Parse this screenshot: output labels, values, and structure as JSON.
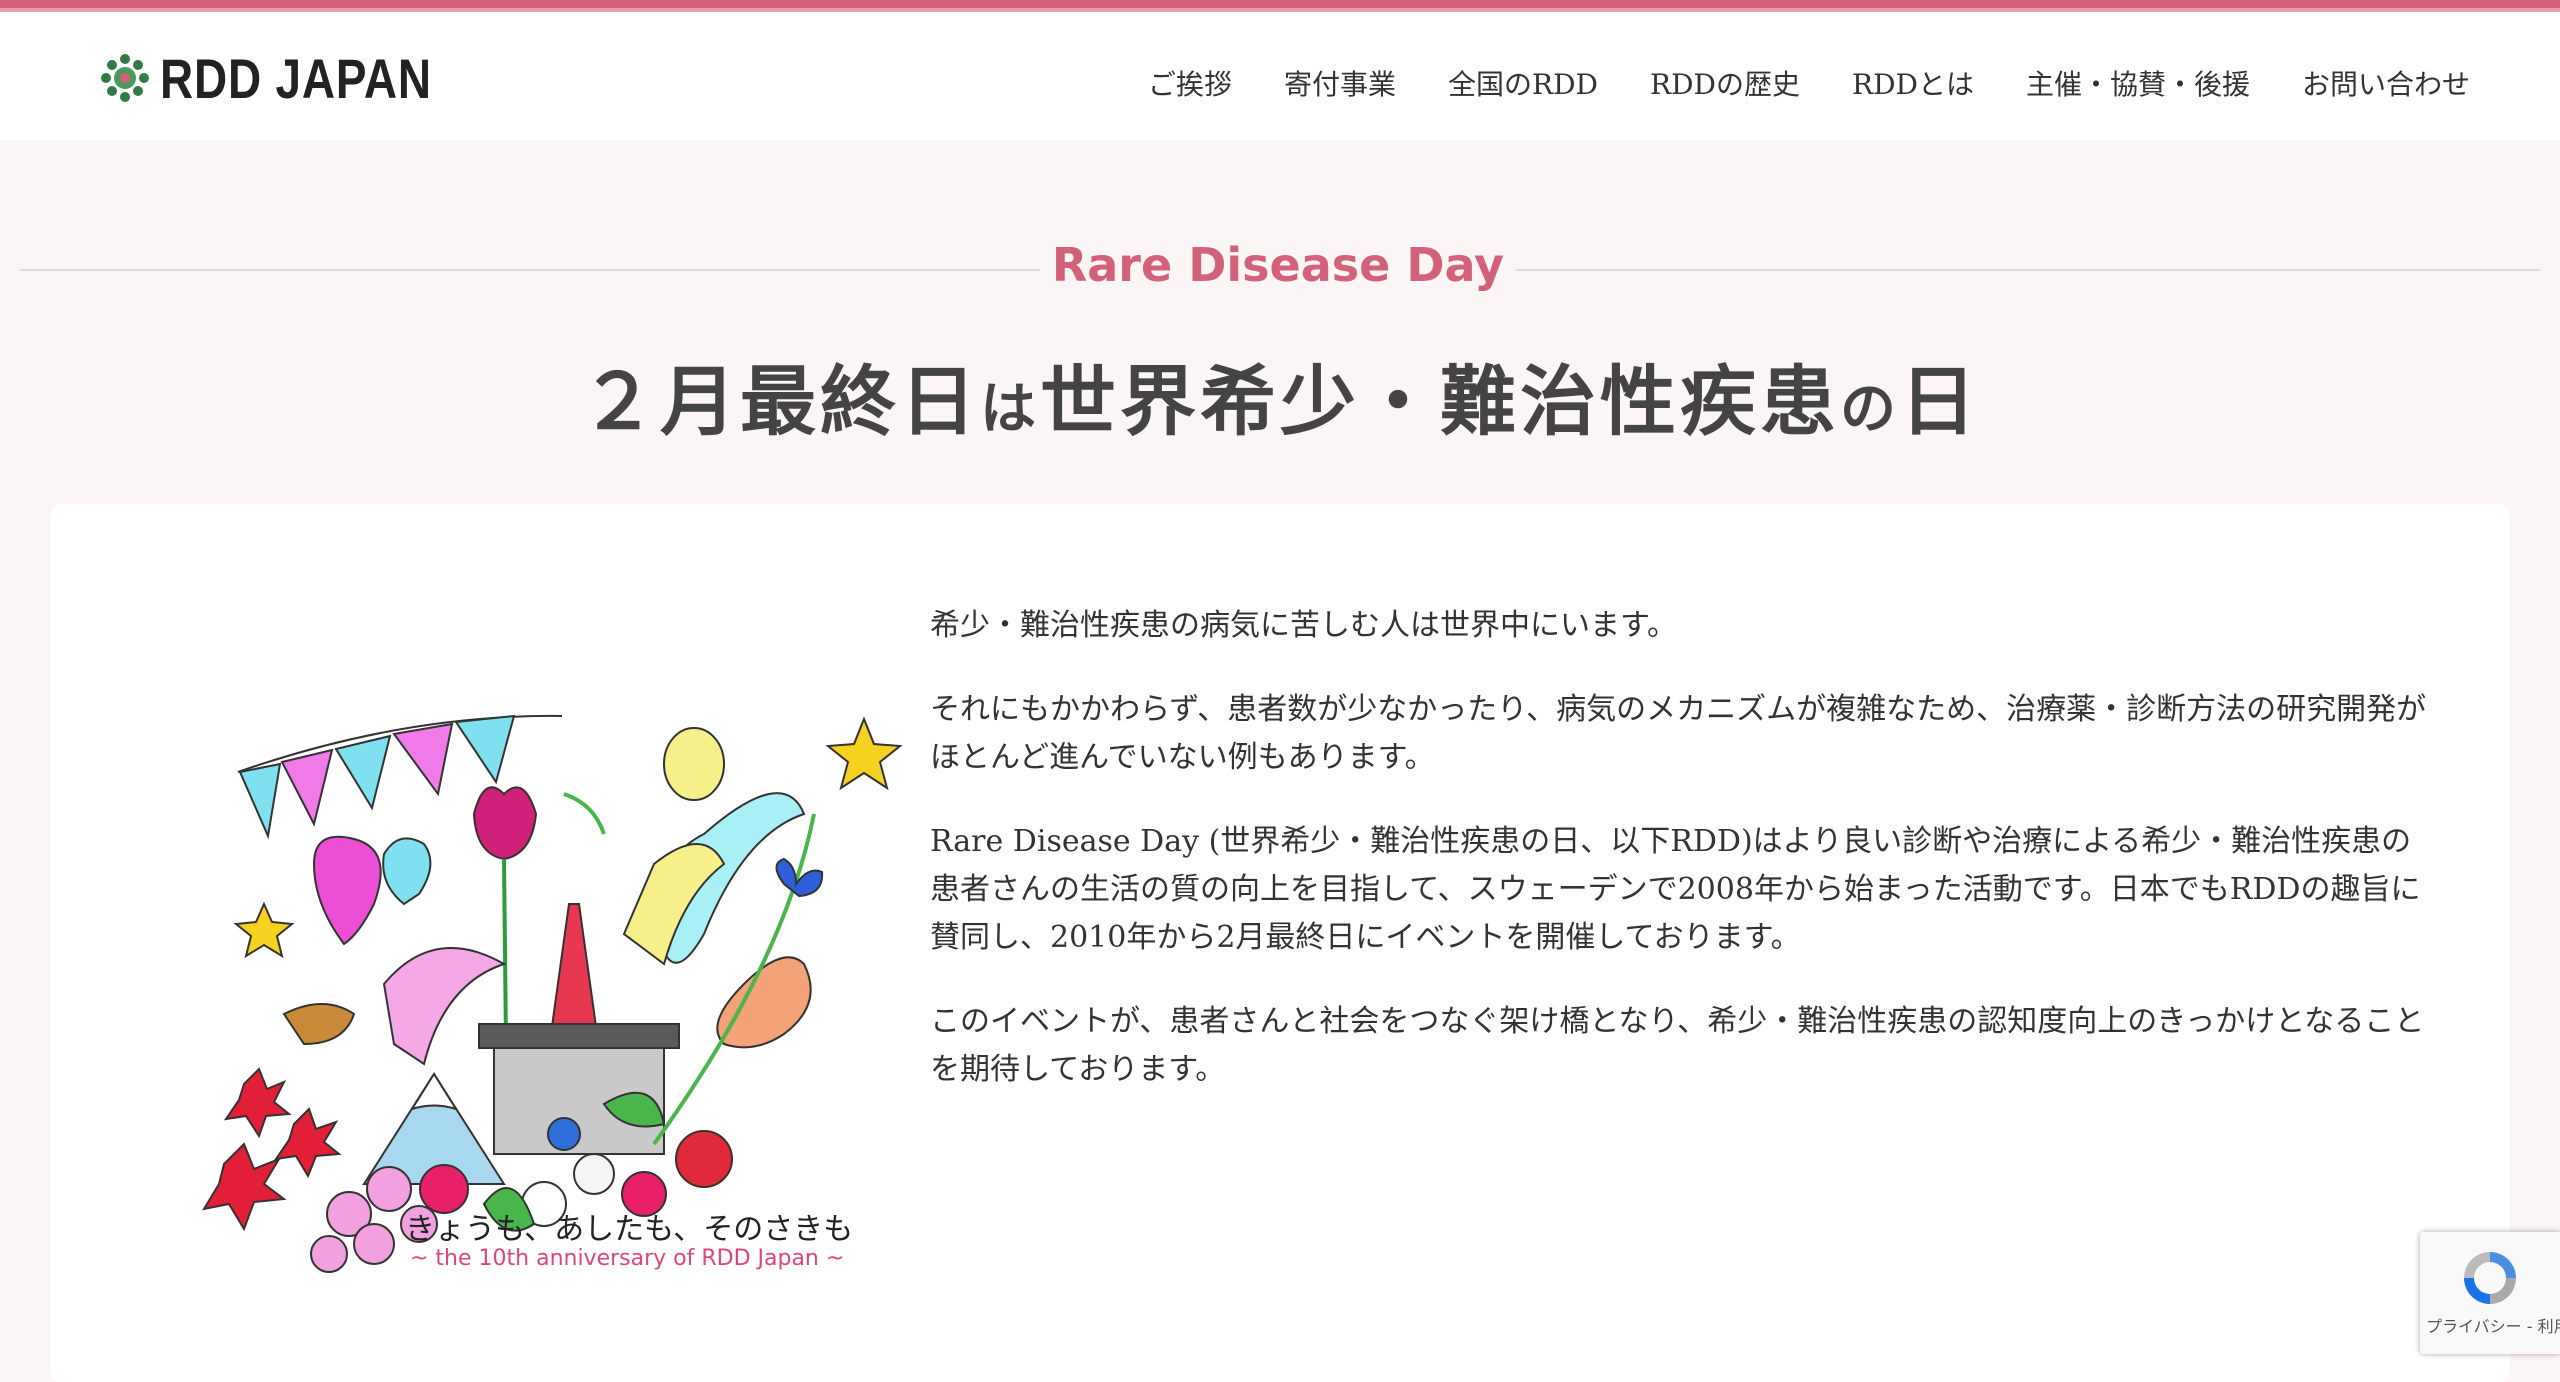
{
  "header": {
    "logo_text": "RDD JAPAN",
    "nav": [
      "ご挨拶",
      "寄付事業",
      "全国のRDD",
      "RDDの歴史",
      "RDDとは",
      "主催・協賛・後援",
      "お問い合わせ"
    ]
  },
  "hero": {
    "eyebrow": "Rare Disease Day",
    "title_parts": [
      "２月最終日",
      "は",
      "世界希少・難治性疾患",
      "の",
      "日"
    ]
  },
  "content": {
    "illustration": {
      "tagline": "きょうも、あしたも、そのさきも",
      "subtitle": "~ the 10th anniversary of RDD Japan ~"
    },
    "paragraphs": [
      "希少・難治性疾患の病気に苦しむ人は世界中にいます。",
      "それにもかかわらず、患者数が少なかったり、病気のメカニズムが複雑なため、治療薬・診断方法の研究開発がほとんど進んでいない例もあります。",
      "Rare Disease Day (世界希少・難治性疾患の日、以下RDD)はより良い診断や治療による希少・難治性疾患の患者さんの生活の質の向上を目指して、スウェーデンで2008年から始まった活動です。日本でもRDDの趣旨に賛同し、2010年から2月最終日にイベントを開催しております。",
      "このイベントが、患者さんと社会をつなぐ架け橋となり、希少・難治性疾患の認知度向上のきっかけとなることを期待しております。"
    ]
  },
  "recaptcha": {
    "links": "プライバシー - 利用規約"
  },
  "colors": {
    "accent": "#d4617a",
    "background": "#fbf5f5",
    "text": "#333333"
  }
}
